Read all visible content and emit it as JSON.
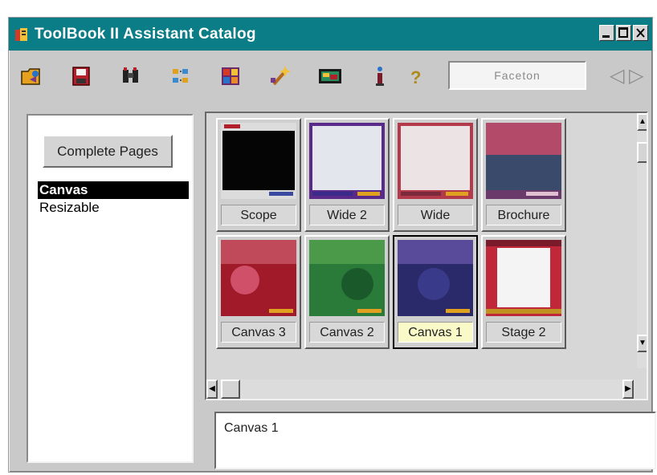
{
  "window": {
    "title": "ToolBook II Assistant Catalog",
    "controls": [
      "minimize",
      "maximize",
      "close"
    ],
    "title_bar_color": "#0b7d86"
  },
  "toolbar": {
    "icons": [
      "open-icon",
      "save-icon",
      "find-icon",
      "arrange-icon",
      "grid-icon",
      "sparkle-icon",
      "screen-icon",
      "info-icon",
      "help-icon"
    ],
    "search_value": "Faceton",
    "nav": {
      "prev": "◁",
      "next": "▷"
    }
  },
  "left_panel": {
    "complete_button_label": "Complete Pages",
    "items": [
      {
        "label": "Canvas",
        "selected": true
      },
      {
        "label": "Resizable",
        "selected": false
      }
    ]
  },
  "catalog": {
    "items": [
      {
        "label": "Scope",
        "selected": false
      },
      {
        "label": "Wide 2",
        "selected": false
      },
      {
        "label": "Wide",
        "selected": false
      },
      {
        "label": "Brochure",
        "selected": false
      },
      {
        "label": "Canvas 3",
        "selected": false
      },
      {
        "label": "Canvas 2",
        "selected": false
      },
      {
        "label": "Canvas 1",
        "selected": true
      },
      {
        "label": "Stage 2",
        "selected": false
      }
    ]
  },
  "description": {
    "text": "Canvas 1"
  },
  "colors": {
    "selection": "#000000",
    "selected_label_bg": "#fafac8"
  }
}
